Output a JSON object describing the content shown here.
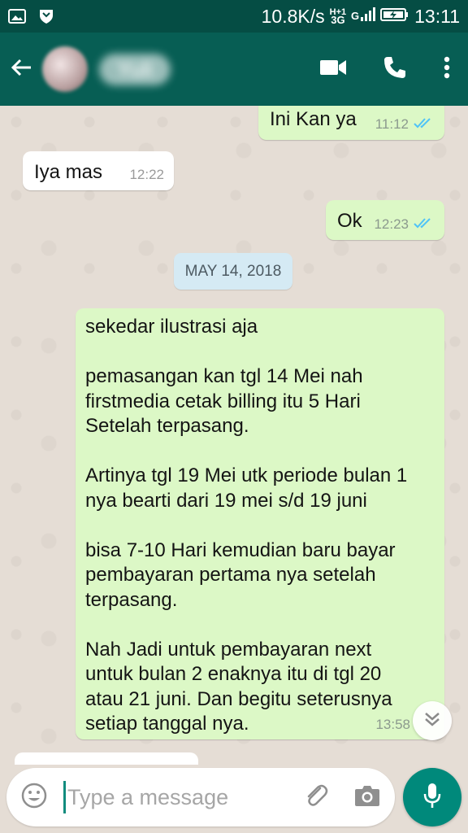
{
  "status_bar": {
    "network_speed": "10.8K/s",
    "network_type": "3G",
    "network_sub": "H+1",
    "time": "13:11",
    "icons": [
      "image-icon",
      "shield-icon",
      "signal-icon",
      "battery-charging-icon"
    ]
  },
  "header": {
    "contact_name": "Yuli",
    "icons": [
      "back-arrow-icon",
      "video-call-icon",
      "voice-call-icon",
      "more-vert-icon"
    ]
  },
  "messages": [
    {
      "direction": "out",
      "text": "Ini Kan ya",
      "time": "11:12",
      "status": "read"
    },
    {
      "direction": "in",
      "text": "Iya mas",
      "time": "12:22"
    },
    {
      "direction": "out",
      "text": "Ok",
      "time": "12:23",
      "status": "read"
    },
    {
      "date_separator": "MAY 14, 2018"
    },
    {
      "direction": "out",
      "text": "sekedar ilustrasi aja\n\npemasangan kan tgl 14 Mei nah\nfirstmedia cetak billing itu 5 Hari\nSetelah  terpasang.\n\nArtinya tgl 19 Mei utk periode bulan 1\nnya bearti dari 19 mei s/d 19 juni\n\nbisa 7-10 Hari kemudian baru bayar\npembayaran pertama nya setelah\nterpasang.\n\nNah Jadi untuk pembayaran next\nuntuk bulan 2 enaknya itu di tgl 20\natau 21 juni. Dan begitu seterusnya\nsetiap tanggal nya.",
      "time": "13:58"
    }
  ],
  "composer": {
    "placeholder": "Type a message",
    "icons": [
      "emoji-icon",
      "attach-icon",
      "camera-icon",
      "mic-icon"
    ]
  },
  "colors": {
    "header": "#075e54",
    "status_bar": "#054d44",
    "outgoing_bubble": "#dcf8c6",
    "incoming_bubble": "#ffffff",
    "read_ticks": "#4fc3f7",
    "mic_button": "#00897b"
  }
}
